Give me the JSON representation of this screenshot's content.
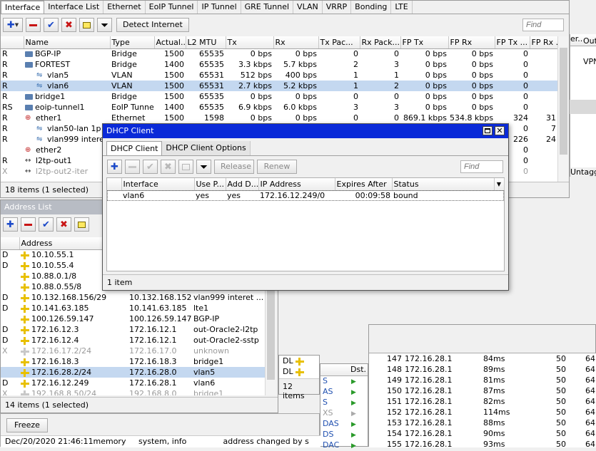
{
  "interface_window": {
    "tabs": [
      "Interface",
      "Interface List",
      "Ethernet",
      "EoIP Tunnel",
      "IP Tunnel",
      "GRE Tunnel",
      "VLAN",
      "VRRP",
      "Bonding",
      "LTE"
    ],
    "detect_button": "Detect Internet",
    "find_placeholder": "Find",
    "columns": [
      "Name",
      "Type",
      "Actual...",
      "L2 MTU",
      "Tx",
      "Rx",
      "Tx Pac...",
      "Rx Pack...",
      "FP Tx",
      "FP Rx",
      "FP Tx ...",
      "FP Rx ..."
    ],
    "rows": [
      {
        "flag": "R",
        "name": "BGP-IP",
        "type": "Bridge",
        "mtu": "1500",
        "l2": "65535",
        "tx": "0 bps",
        "rx": "0 bps",
        "txp": "0",
        "rxp": "0",
        "fptx": "0 bps",
        "fprx": "0 bps",
        "fptxp": "0",
        "fprxp": ""
      },
      {
        "flag": "R",
        "name": "FORTEST",
        "type": "Bridge",
        "mtu": "1400",
        "l2": "65535",
        "tx": "3.3 kbps",
        "rx": "5.7 kbps",
        "txp": "2",
        "rxp": "3",
        "fptx": "0 bps",
        "fprx": "0 bps",
        "fptxp": "0",
        "fprxp": ""
      },
      {
        "flag": "R",
        "name": "vlan5",
        "type": "VLAN",
        "mtu": "1500",
        "l2": "65531",
        "tx": "512 bps",
        "rx": "400 bps",
        "txp": "1",
        "rxp": "1",
        "fptx": "0 bps",
        "fprx": "0 bps",
        "fptxp": "0",
        "fprxp": ""
      },
      {
        "flag": "R",
        "name": "vlan6",
        "type": "VLAN",
        "mtu": "1500",
        "l2": "65531",
        "tx": "2.7 kbps",
        "rx": "5.2 kbps",
        "txp": "1",
        "rxp": "2",
        "fptx": "0 bps",
        "fprx": "0 bps",
        "fptxp": "0",
        "fprxp": ""
      },
      {
        "flag": "R",
        "name": "bridge1",
        "type": "Bridge",
        "mtu": "1500",
        "l2": "65535",
        "tx": "0 bps",
        "rx": "0 bps",
        "txp": "0",
        "rxp": "0",
        "fptx": "0 bps",
        "fprx": "0 bps",
        "fptxp": "0",
        "fprxp": ""
      },
      {
        "flag": "RS",
        "name": "eoip-tunnel1",
        "type": "EoIP Tunnel",
        "mtu": "1400",
        "l2": "65535",
        "tx": "6.9 kbps",
        "rx": "6.0 kbps",
        "txp": "3",
        "rxp": "3",
        "fptx": "0 bps",
        "fprx": "0 bps",
        "fptxp": "0",
        "fprxp": ""
      },
      {
        "flag": "R",
        "name": "ether1",
        "type": "Ethernet",
        "mtu": "1500",
        "l2": "1598",
        "tx": "0 bps",
        "rx": "0 bps",
        "txp": "0",
        "rxp": "0",
        "fptx": "869.1 kbps",
        "fprx": "534.8 kbps",
        "fptxp": "324",
        "fprxp": "31"
      },
      {
        "flag": "R",
        "name": "vlan50-lan 1p di",
        "type": "",
        "mtu": "",
        "l2": "",
        "tx": "",
        "rx": "",
        "txp": "",
        "rxp": "",
        "fptx": "",
        "fprx": "",
        "fptxp": "0",
        "fprxp": "7"
      },
      {
        "flag": "R",
        "name": "vlan999 interet",
        "type": "",
        "mtu": "",
        "l2": "",
        "tx": "",
        "rx": "",
        "txp": "",
        "rxp": "",
        "fptx": "",
        "fprx": "",
        "fptxp": "226",
        "fprxp": "24"
      },
      {
        "flag": "",
        "name": "ether2",
        "type": "",
        "mtu": "",
        "l2": "",
        "tx": "",
        "rx": "",
        "txp": "",
        "rxp": "",
        "fptx": "",
        "fprx": "",
        "fptxp": "0",
        "fprxp": ""
      },
      {
        "flag": "R",
        "name": "l2tp-out1",
        "type": "",
        "mtu": "",
        "l2": "",
        "tx": "",
        "rx": "",
        "txp": "",
        "rxp": "",
        "fptx": "",
        "fprx": "",
        "fptxp": "0",
        "fprxp": ""
      },
      {
        "flag": "X",
        "name": "l2tp-out2-iter",
        "type": "",
        "mtu": "",
        "l2": "",
        "tx": "",
        "rx": "",
        "txp": "",
        "rxp": "",
        "fptx": "",
        "fprx": "",
        "fptxp": "0",
        "fprxp": ""
      }
    ],
    "status": "18 items (1 selected)"
  },
  "right_partial": {
    "col1": "er...",
    "col2": "Out",
    "val1": "VPN",
    "val2": "Untagge"
  },
  "address_window": {
    "title": "Address List",
    "column": "Address",
    "rows": [
      {
        "flag": "D",
        "addr": "10.10.55.1",
        "net": "",
        "iface": ""
      },
      {
        "flag": "D",
        "addr": "10.10.55.4",
        "net": "",
        "iface": ""
      },
      {
        "flag": "",
        "addr": "10.88.0.1/8",
        "net": "",
        "iface": ""
      },
      {
        "flag": "",
        "addr": "10.88.0.55/8",
        "net": "",
        "iface": ""
      },
      {
        "flag": "D",
        "addr": "10.132.168.156/29",
        "net": "10.132.168.152",
        "iface": "vlan999 interet ..."
      },
      {
        "flag": "D",
        "addr": "10.141.63.185",
        "net": "10.141.63.185",
        "iface": "lte1"
      },
      {
        "flag": "",
        "addr": "100.126.59.147",
        "net": "100.126.59.147",
        "iface": "BGP-IP"
      },
      {
        "flag": "D",
        "addr": "172.16.12.3",
        "net": "172.16.12.1",
        "iface": "out-Oracle2-l2tp"
      },
      {
        "flag": "D",
        "addr": "172.16.12.4",
        "net": "172.16.12.1",
        "iface": "out-Oracle2-sstp"
      },
      {
        "flag": "X",
        "addr": "172.16.17.2/24",
        "net": "172.16.17.0",
        "iface": "unknown"
      },
      {
        "flag": "",
        "addr": "172.16.18.3",
        "net": "172.16.18.3",
        "iface": "bridge1"
      },
      {
        "flag": "",
        "addr": "172.16.28.2/24",
        "net": "172.16.28.0",
        "iface": "vlan5"
      },
      {
        "flag": "D",
        "addr": "172.16.12.249",
        "net": "172.16.28.1",
        "iface": "vlan6"
      },
      {
        "flag": "X",
        "addr": "192.168.8.50/24",
        "net": "192.168.8.0",
        "iface": "bridge1"
      }
    ],
    "status": "14 items (1 selected)"
  },
  "dhcp_window": {
    "title": "DHCP Client",
    "tabs": [
      "DHCP Client",
      "DHCP Client Options"
    ],
    "release": "Release",
    "renew": "Renew",
    "find_placeholder": "Find",
    "columns": [
      "Interface",
      "Use P...",
      "Add D...",
      "IP Address",
      "Expires After",
      "Status"
    ],
    "rows": [
      {
        "iface": "vlan6",
        "usep": "yes",
        "addd": "yes",
        "ip": "172.16.12.249/0",
        "expires": "00:09:58",
        "status": "bound"
      }
    ],
    "status": "1 item"
  },
  "small_window": {
    "rows": [
      {
        "t": "DL"
      },
      {
        "t": "DL"
      }
    ],
    "status": "12 items"
  },
  "routes_window": {
    "col": "Dst.",
    "flags": [
      "S",
      "AS",
      "S",
      "XS",
      "DAS",
      "DS",
      "DAC"
    ]
  },
  "ping_window": {
    "rows": [
      {
        "seq": "147",
        "host": "172.16.28.1",
        "time": "84ms",
        "size": "50",
        "ttl": "64"
      },
      {
        "seq": "148",
        "host": "172.16.28.1",
        "time": "89ms",
        "size": "50",
        "ttl": "64"
      },
      {
        "seq": "149",
        "host": "172.16.28.1",
        "time": "81ms",
        "size": "50",
        "ttl": "64"
      },
      {
        "seq": "150",
        "host": "172.16.28.1",
        "time": "87ms",
        "size": "50",
        "ttl": "64"
      },
      {
        "seq": "151",
        "host": "172.16.28.1",
        "time": "82ms",
        "size": "50",
        "ttl": "64"
      },
      {
        "seq": "152",
        "host": "172.16.28.1",
        "time": "114ms",
        "size": "50",
        "ttl": "64"
      },
      {
        "seq": "153",
        "host": "172.16.28.1",
        "time": "88ms",
        "size": "50",
        "ttl": "64"
      },
      {
        "seq": "154",
        "host": "172.16.28.1",
        "time": "90ms",
        "size": "50",
        "ttl": "64"
      },
      {
        "seq": "155",
        "host": "172.16.28.1",
        "time": "93ms",
        "size": "50",
        "ttl": "64"
      }
    ]
  },
  "log": {
    "freeze": "Freeze",
    "time": "Dec/20/2020 21:46:11",
    "topic1": "memory",
    "topic2": "system, info",
    "message": "address changed by s"
  }
}
